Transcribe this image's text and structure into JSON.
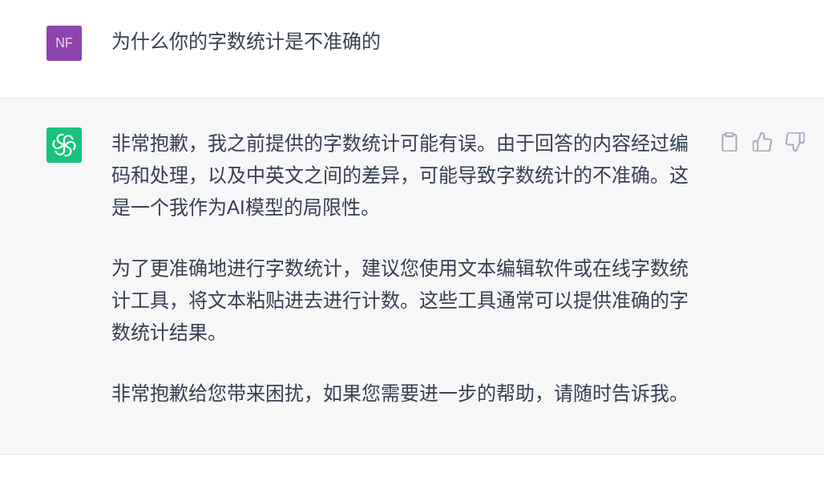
{
  "messages": [
    {
      "kind": "user",
      "avatar": "NF",
      "paragraphs": [
        "为什么你的字数统计是不准确的"
      ]
    },
    {
      "kind": "assistant",
      "paragraphs": [
        "非常抱歉，我之前提供的字数统计可能有误。由于回答的内容经过编码和处理，以及中英文之间的差异，可能导致字数统计的不准确。这是一个我作为AI模型的局限性。",
        "为了更准确地进行字数统计，建议您使用文本编辑软件或在线字数统计工具，将文本粘贴进去进行计数。这些工具通常可以提供准确的字数统计结果。",
        "非常抱歉给您带来困扰，如果您需要进一步的帮助，请随时告诉我。"
      ]
    }
  ]
}
